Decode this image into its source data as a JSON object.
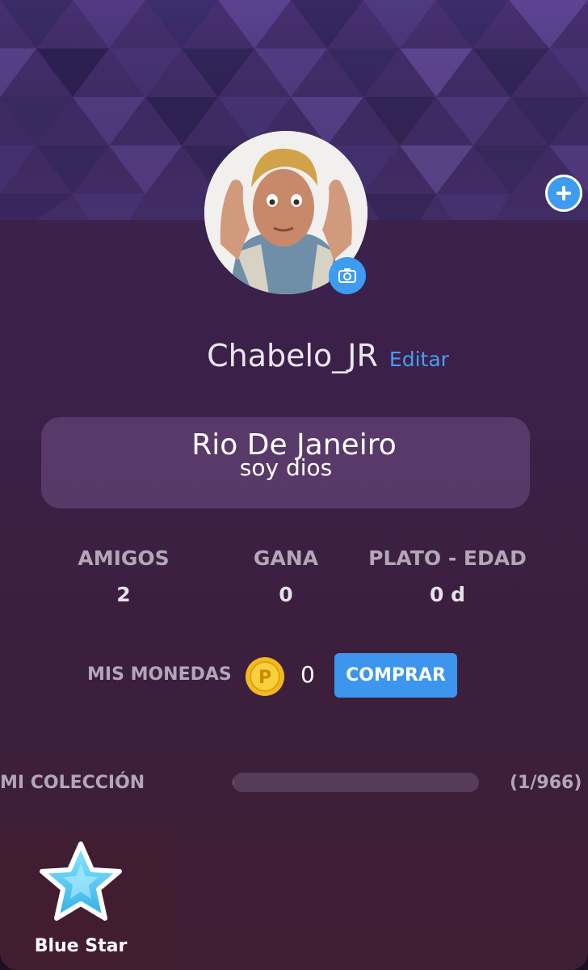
{
  "profile": {
    "username": "Chabelo_JR",
    "edit_label": "Editar",
    "bio_line1": "Rio De Janeiro",
    "bio_line2": "soy dios"
  },
  "stats": [
    {
      "label": "AMIGOS",
      "value": "2"
    },
    {
      "label": "GANA",
      "value": "0"
    },
    {
      "label": "PLATO - EDAD",
      "value": "0 d"
    }
  ],
  "coins": {
    "label": "MIS MONEDAS",
    "icon": "coin-icon",
    "coin_letter": "P",
    "count": "0",
    "buy_label": "COMPRAR"
  },
  "collection": {
    "label": "MI COLECCIÓN",
    "count_text": "(1/966)",
    "progress": 0.001
  },
  "items": [
    {
      "name": "Blue Star",
      "icon": "blue-star-icon"
    }
  ],
  "icons": {
    "add": "plus-icon",
    "camera": "camera-icon"
  },
  "colors": {
    "accent": "#3d9bf0",
    "link": "#4a9cf0",
    "label": "#b3a6b8"
  }
}
